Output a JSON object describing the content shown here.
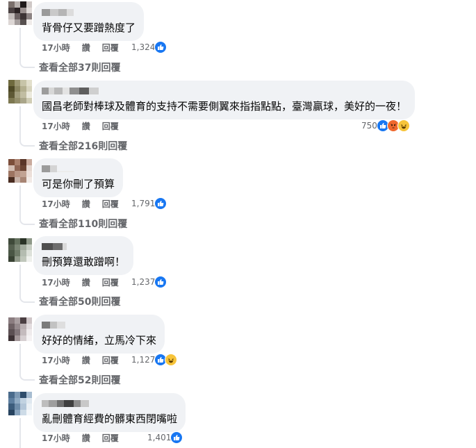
{
  "comments": [
    {
      "text": "背骨仔又要蹭熱度了",
      "time": "17小時",
      "like": "讚",
      "reply": "回覆",
      "reactions": "1,324",
      "view_replies": "查看全部37則回覆",
      "avatar_colors": [
        "#7a6f6b",
        "#b7b0ad",
        "#1f1a1a",
        "#cfc9c7",
        "#4a4142",
        "#2a2223",
        "#998f8e",
        "#e0dad8",
        "#c3bdbb",
        "#6c6263",
        "#3d3435",
        "#8b8282",
        "#ddd7d5",
        "#a59e9d",
        "#57504f",
        "#f0ecea"
      ]
    },
    {
      "text": "國昌老師對棒球及體育的支持不需要側翼來指指點點，臺灣贏球，美好的一夜！",
      "time": "17小時",
      "like": "讚",
      "reply": "回覆",
      "reactions": "750",
      "view_replies": "查看全部216則回覆",
      "avatar_colors": [
        "#6f6a3e",
        "#9c9773",
        "#c7c4a8",
        "#e2dfcc",
        "#4f4a26",
        "#8a8560",
        "#b3af8f",
        "#d6d3bd",
        "#5e5935",
        "#a29e7e",
        "#c1bda2",
        "#ebe9dc",
        "#7d7851",
        "#948f6c",
        "#aaa68a",
        "#d0cdb5"
      ]
    },
    {
      "text": "可是你刪了預算",
      "time": "17小時",
      "like": "讚",
      "reply": "回覆",
      "reactions": "1,791",
      "view_replies": "查看全部110則回覆",
      "avatar_colors": [
        "#7c4e3a",
        "#a97f6c",
        "#5a3628",
        "#c9aa9c",
        "#d3bdb2",
        "#8e6453",
        "#6b4433",
        "#e4d6cf",
        "#9d7461",
        "#b89585",
        "#c2a393",
        "#ecdfd9",
        "#4a2c20",
        "#c7b2a8",
        "#a88574",
        "#f2eae6"
      ]
    },
    {
      "text": "刪預算還敢蹭啊！",
      "time": "17小時",
      "like": "讚",
      "reply": "回覆",
      "reactions": "1,237",
      "view_replies": "查看全部50則回覆",
      "avatar_colors": [
        "#3f4a3a",
        "#63705d",
        "#2a3326",
        "#8e9888",
        "#55604f",
        "#7b8675",
        "#a2ab9d",
        "#c8cec4",
        "#4a5645",
        "#6e7a68",
        "#b4bcb0",
        "#dde1da",
        "#384233",
        "#90998a",
        "#c0c7bb",
        "#eef0ec"
      ]
    },
    {
      "text": "好好的情緒，立馬冷下來",
      "time": "17小時",
      "like": "讚",
      "reply": "回覆",
      "reactions": "1,127",
      "view_replies": "查看全部52則回覆",
      "avatar_colors": [
        "#8b7d80",
        "#a99ea0",
        "#4b3f42",
        "#cfc6c8",
        "#6e6164",
        "#968a8d",
        "#b9afb1",
        "#e3dddf",
        "#5c5053",
        "#82767a",
        "#c4bbbd",
        "#efebec",
        "#3d3235",
        "#a39799",
        "#d6cfd1",
        "#f5f2f3"
      ]
    },
    {
      "text": "亂刪體育經費的髒東西閉嘴啦",
      "time": "17小時",
      "like": "讚",
      "reply": "回覆",
      "reactions": "1,401",
      "view_replies": "",
      "avatar_colors": [
        "#4a6b8c",
        "#7e9ab5",
        "#2f4d6b",
        "#a7bdd1",
        "#5d7e9f",
        "#90abc4",
        "#c1d2e1",
        "#dfe8f0",
        "#3c5c7c",
        "#6f8daa",
        "#b3c6d8",
        "#eaf0f5",
        "#27435f",
        "#88a3bd",
        "#cddbe7",
        "#f4f7fa"
      ]
    }
  ],
  "colors": {
    "bubble": "#f0f2f5",
    "meta": "#65676b",
    "like_blue": "#1877f2"
  }
}
